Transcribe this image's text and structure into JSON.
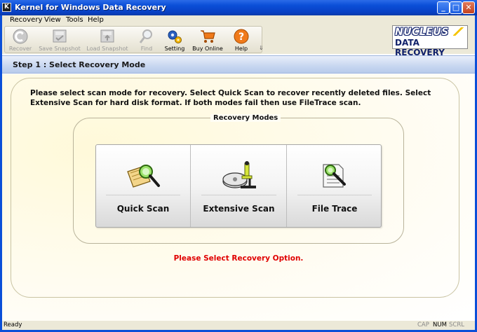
{
  "window": {
    "app_icon": "K",
    "title": "Kernel for Windows Data Recovery",
    "min_glyph": "_",
    "max_glyph": "□",
    "close_glyph": "✕"
  },
  "menu": [
    "Recovery",
    "View",
    "Tools",
    "Help"
  ],
  "toolbar": {
    "buttons": [
      {
        "label": "Recover",
        "icon": "recover-icon",
        "enabled": false
      },
      {
        "label": "Save Snapshot",
        "icon": "save-snapshot-icon",
        "enabled": false
      },
      {
        "label": "Load Snapshot",
        "icon": "load-snapshot-icon",
        "enabled": false
      },
      {
        "label": "Find",
        "icon": "find-icon",
        "enabled": false
      },
      {
        "label": "Setting",
        "icon": "gears-icon",
        "enabled": true
      },
      {
        "label": "Buy Online",
        "icon": "shopping-cart-icon",
        "enabled": true
      },
      {
        "label": "Help",
        "icon": "help-icon",
        "enabled": true
      }
    ],
    "overflow_glyph": "⇓"
  },
  "logo": {
    "line1": "NUCLEUS",
    "line2": "DATA RECOVERY"
  },
  "step": {
    "title": "Step 1 : Select Recovery Mode"
  },
  "instructions": "Please select scan mode for recovery. Select Quick Scan to recover recently deleted files. Select Extensive Scan for hard disk format. If both modes fail then use FileTrace scan.",
  "modes": {
    "legend": "Recovery Modes",
    "items": [
      {
        "label": "Quick Scan",
        "icon": "quick-scan-icon"
      },
      {
        "label": "Extensive Scan",
        "icon": "extensive-scan-icon"
      },
      {
        "label": "File Trace",
        "icon": "file-trace-icon"
      }
    ]
  },
  "message": "Please Select Recovery Option.",
  "status": {
    "text": "Ready",
    "indicators": [
      {
        "label": "CAP",
        "active": false
      },
      {
        "label": "NUM",
        "active": true
      },
      {
        "label": "SCRL",
        "active": false
      }
    ]
  },
  "colors": {
    "titlebar": "#0b4fd8",
    "accent_red": "#e00000",
    "header_blue": "#c7d6f0",
    "logo_navy": "#10206a"
  }
}
